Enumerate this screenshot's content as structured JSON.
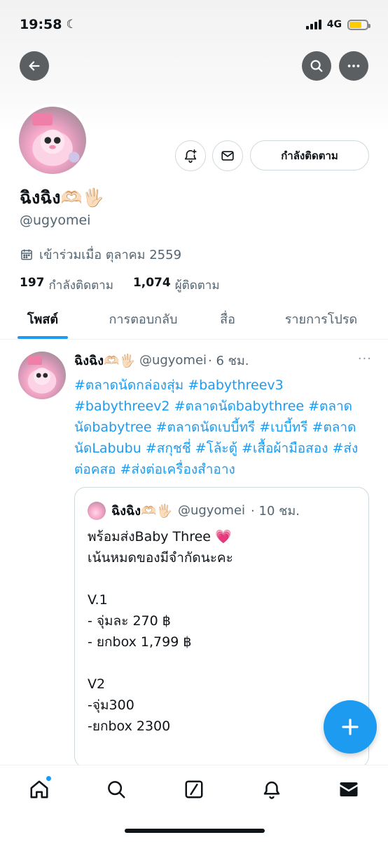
{
  "status_bar": {
    "time": "19:58",
    "network": "4G",
    "moon": "☾",
    "battery_level": 0.7,
    "battery_color": "#ffcc00"
  },
  "profile": {
    "name": "ฉิงฉิง🫶🏻🖐🏻",
    "handle": "@ugyomei",
    "joined": "เข้าร่วมเมื่อ ตุลาคม 2559",
    "following_count": "197",
    "following_label": "กำลังติดตาม",
    "followers_count": "1,074",
    "followers_label": "ผู้ติดตาม",
    "follow_button": "กำลังติดตาม"
  },
  "tabs": [
    {
      "label": "โพสต์"
    },
    {
      "label": "การตอบกลับ"
    },
    {
      "label": "สื่อ"
    },
    {
      "label": "รายการโปรด"
    }
  ],
  "tweet": {
    "name": "ฉิงฉิง🫶🏻🖐🏻",
    "handle": "@ugyomei",
    "time": "· 6 ชม.",
    "text": "#ตลาดนัดกล่องสุ่ม #babythreev3 #babythreev2 #ตลาดนัดbabythree #ตลาดนัดbabytree #ตลาดนัดเบบี้ทรี #เบบี้ทรี #ตลาดนัดLabubu #สกุชชี่ #โล้ะตู้ #เสื้อผ้ามือสอง #ส่งต่อคสอ #ส่งต่อเครื่องสำอาง",
    "more": "···",
    "quote": {
      "name": "ฉิงฉิง🫶🏻🖐🏻",
      "handle": "@ugyomei",
      "time": "· 10 ชม.",
      "text": "พร้อมส่งBaby Three 💗\nเน้นหมดของมีจำกัดนะคะ\n\nV.1\n- จุ่มละ 270 ฿\n- ยกbox 1,799 ฿\n\nV2\n-จุ่ม300\n-ยกbox 2300"
    }
  },
  "icons": {
    "back": "arrow-left-icon",
    "search": "search-icon",
    "more": "more-icon",
    "notify": "bell-plus-icon",
    "message": "envelope-icon",
    "calendar": "calendar-icon",
    "compose": "plus-icon"
  },
  "colors": {
    "accent": "#1d9bf0",
    "text": "#0f1419",
    "muted": "#536471"
  }
}
